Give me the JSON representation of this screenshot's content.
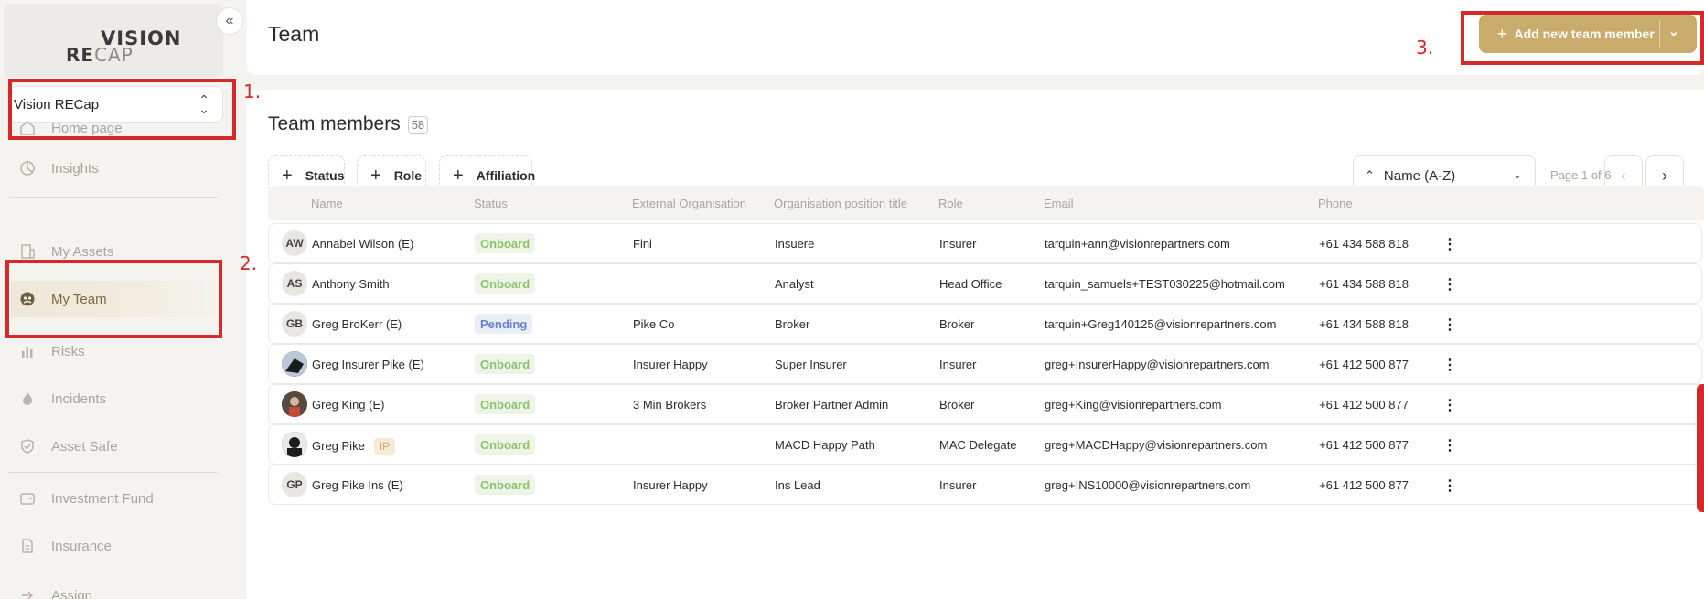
{
  "sidebar": {
    "logo": {
      "line1": "VISION",
      "line2a": "RE",
      "line2b": "CAP"
    },
    "collapse_icon": "double-chevron-left",
    "org_select": {
      "value": "Vision RECap"
    },
    "items": [
      {
        "label": "Home page",
        "icon": "home-icon"
      },
      {
        "label": "Insights",
        "icon": "pie-chart-icon"
      },
      {
        "label": "My Assets",
        "icon": "building-icon"
      },
      {
        "label": "My Team",
        "icon": "team-icon",
        "active": true
      },
      {
        "label": "Risks",
        "icon": "bar-chart-icon"
      },
      {
        "label": "Incidents",
        "icon": "flame-icon"
      },
      {
        "label": "Asset Safe",
        "icon": "shield-icon"
      },
      {
        "label": "Investment Fund",
        "icon": "wallet-icon"
      },
      {
        "label": "Insurance",
        "icon": "document-icon"
      },
      {
        "label": "Assign",
        "icon": "arrow-icon"
      }
    ]
  },
  "annotations": {
    "one": "1.",
    "two": "2.",
    "three": "3."
  },
  "header": {
    "title": "Team",
    "add_button_label": "Add new team member"
  },
  "main": {
    "section_title": "Team members",
    "member_count": "58",
    "filters": [
      "Status",
      "Role",
      "Affiliation"
    ],
    "sort": {
      "value": "Name (A-Z)"
    },
    "pager": {
      "text": "Page 1 of 6"
    },
    "columns": [
      "Name",
      "Status",
      "External Organisation",
      "Organisation position title",
      "Role",
      "Email",
      "Phone"
    ],
    "rows": [
      {
        "initials": "AW",
        "name": "Annabel Wilson (E)",
        "status": "Onboard",
        "org": "Fini",
        "position": "Insuere",
        "role": "Insurer",
        "email": "tarquin+ann@visionrepartners.com",
        "phone": "+61 434 588 818"
      },
      {
        "initials": "AS",
        "name": "Anthony Smith",
        "status": "Onboard",
        "org": "",
        "position": "Analyst",
        "role": "Head Office",
        "email": "tarquin_samuels+TEST030225@hotmail.com",
        "phone": "+61 434 588 818"
      },
      {
        "initials": "GB",
        "name": "Greg BroKerr (E)",
        "status": "Pending",
        "org": "Pike Co",
        "position": "Broker",
        "role": "Broker",
        "email": "tarquin+Greg140125@visionrepartners.com",
        "phone": "+61 434 588 818"
      },
      {
        "initials": "",
        "name": "Greg Insurer Pike (E)",
        "status": "Onboard",
        "org": "Insurer Happy",
        "position": "Super Insurer",
        "role": "Insurer",
        "email": "greg+InsurerHappy@visionrepartners.com",
        "phone": "+61 412 500 877"
      },
      {
        "initials": "",
        "name": "Greg King (E)",
        "status": "Onboard",
        "org": "3 Min Brokers",
        "position": "Broker Partner Admin",
        "role": "Broker",
        "email": "greg+King@visionrepartners.com",
        "phone": "+61 412 500 877"
      },
      {
        "initials": "",
        "name": "Greg Pike",
        "tag": "IP",
        "status": "Onboard",
        "org": "",
        "position": "MACD Happy Path",
        "role": "MAC Delegate",
        "email": "greg+MACDHappy@visionrepartners.com",
        "phone": "+61 412 500 877"
      },
      {
        "initials": "GP",
        "name": "Greg Pike Ins (E)",
        "status": "Onboard",
        "org": "Insurer Happy",
        "position": "Ins Lead",
        "role": "Insurer",
        "email": "greg+INS10000@visionrepartners.com",
        "phone": "+61 412 500 877"
      }
    ]
  },
  "colors": {
    "accent": "#c9ab6b",
    "annotation": "#d62a2a",
    "onboard": "#8bc26a",
    "pending": "#6a82c9"
  }
}
